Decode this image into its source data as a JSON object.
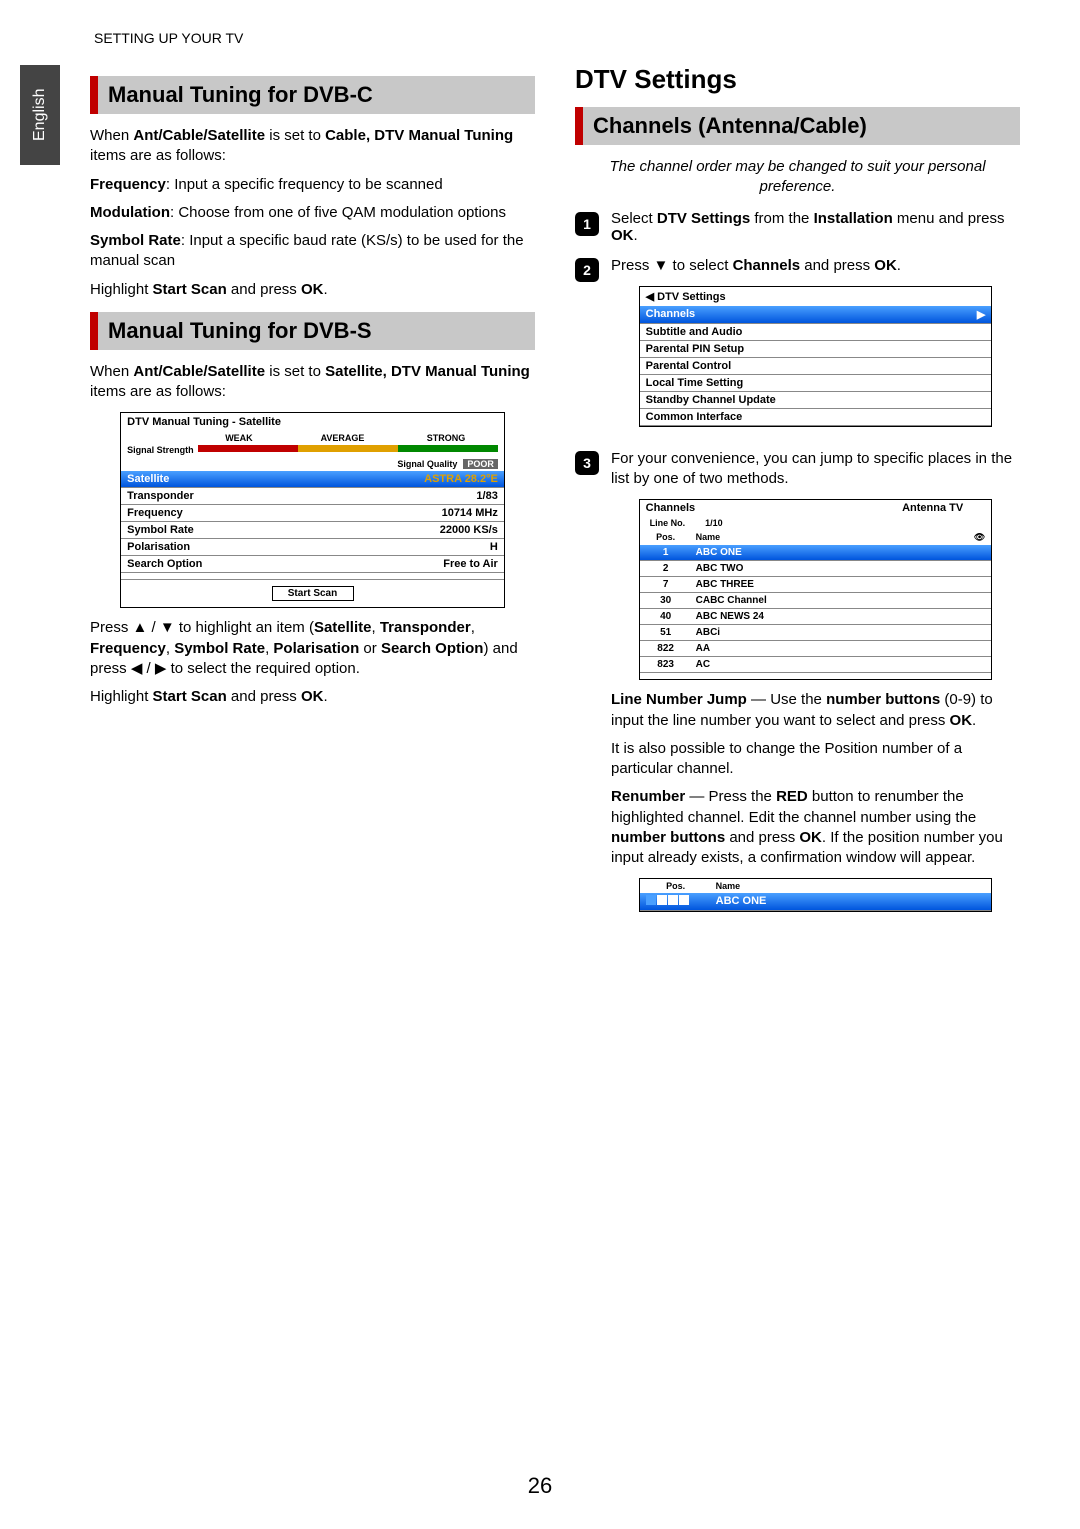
{
  "header": "SETTING UP YOUR TV",
  "lang_tab": "English",
  "page_number": "26",
  "left": {
    "h1": "Manual Tuning for DVB-C",
    "p1a": "When ",
    "p1b": "Ant/Cable/Satellite",
    "p1c": " is set to ",
    "p1d": "Cable, DTV Manual Tuning",
    "p1e": " items are as follows:",
    "freq_label": "Frequency",
    "freq_text": ": Input a specific frequency to be scanned",
    "mod_label": "Modulation",
    "mod_text": ": Choose from one of five QAM modulation options",
    "sym_label": "Symbol Rate",
    "sym_text": ": Input a specific baud rate (KS/s) to be used for the manual scan",
    "hl1a": "Highlight ",
    "hl1b": "Start Scan",
    "hl1c": " and press ",
    "hl1d": "OK",
    "hl1e": ".",
    "h2": "Manual Tuning for DVB-S",
    "p2a": "When ",
    "p2b": "Ant/Cable/Satellite",
    "p2c": " is set to ",
    "p2d": "Satellite, DTV Manual Tuning",
    "p2e": " items are as follows:",
    "sat_ui": {
      "title": "DTV Manual Tuning - Satellite",
      "weak": "WEAK",
      "avg": "AVERAGE",
      "strong": "STRONG",
      "strength": "Signal Strength",
      "quality": "Signal Quality",
      "poor": "POOR",
      "sat_label": "Satellite",
      "sat_val": "ASTRA 28.2°E",
      "rows": [
        {
          "l": "Transponder",
          "r": "1/83"
        },
        {
          "l": "Frequency",
          "r": "10714 MHz"
        },
        {
          "l": "Symbol Rate",
          "r": "22000 KS/s"
        },
        {
          "l": "Polarisation",
          "r": "H"
        },
        {
          "l": "Search Option",
          "r": "Free to Air"
        }
      ],
      "start": "Start Scan"
    },
    "p3a": "Press ▲ / ▼ to highlight an item (",
    "p3b": "Satellite",
    "p3c": ", ",
    "p3d": "Transponder",
    "p3e": ", ",
    "p3f": "Frequency",
    "p3g": ", ",
    "p3h": "Symbol Rate",
    "p3i": ", ",
    "p3j": "Polarisation",
    "p3k": " or ",
    "p3l": "Search Option",
    "p3m": ") and press ◀ / ▶ to select the required option.",
    "hl2a": "Highlight ",
    "hl2b": "Start Scan",
    "hl2c": " and press ",
    "hl2d": "OK",
    "hl2e": "."
  },
  "right": {
    "main": "DTV Settings",
    "h1": "Channels (Antenna/Cable)",
    "italic": "The channel order may be changed to suit your personal preference.",
    "s1a": "Select ",
    "s1b": "DTV Settings",
    "s1c": " from the ",
    "s1d": "Installation",
    "s1e": " menu and press ",
    "s1f": "OK",
    "s1g": ".",
    "s2a": "Press ▼ to select ",
    "s2b": "Channels",
    "s2c": " and press ",
    "s2d": "OK",
    "s2e": ".",
    "dtv_ui": {
      "back": "◀ DTV Settings",
      "items": [
        "Channels",
        "Subtitle and Audio",
        "Parental PIN Setup",
        "Parental Control",
        "Local Time Setting",
        "Standby Channel Update",
        "Common Interface"
      ]
    },
    "s3": "For your convenience, you can jump to specific places in the list by one of two methods.",
    "ch_ui": {
      "title": "Channels",
      "source": "Antenna TV",
      "line": "Line No.",
      "line_val": "1/10",
      "pos": "Pos.",
      "name": "Name",
      "rows": [
        {
          "p": "1",
          "n": "ABC ONE",
          "sel": true
        },
        {
          "p": "2",
          "n": "ABC TWO"
        },
        {
          "p": "7",
          "n": "ABC THREE"
        },
        {
          "p": "30",
          "n": "CABC Channel"
        },
        {
          "p": "40",
          "n": "ABC NEWS 24"
        },
        {
          "p": "51",
          "n": "ABCi"
        },
        {
          "p": "822",
          "n": "AA"
        },
        {
          "p": "823",
          "n": "AC"
        }
      ]
    },
    "ln1": "Line Number Jump",
    "ln2": " — Use the ",
    "ln3": "number buttons",
    "ln4": " (0-9) to input the line number you want to select and press ",
    "ln5": "OK",
    "ln6": ".",
    "pos_change": "It is also possible to change the Position number of a particular channel.",
    "rn1": "Renumber",
    "rn2": " — Press the ",
    "rn3": "RED",
    "rn4": " button to renumber the highlighted channel. Edit the channel number using the ",
    "rn5": "number buttons",
    "rn6": " and press ",
    "rn7": "OK",
    "rn8": ". If the position number you input already exists, a confirmation window will appear.",
    "renum_ui": {
      "pos": "Pos.",
      "name": "Name",
      "val": "ABC ONE"
    }
  }
}
